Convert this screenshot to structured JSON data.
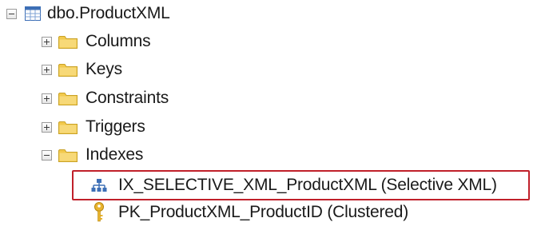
{
  "tree": {
    "root": {
      "label": "dbo.ProductXML",
      "icon": "table-icon",
      "state": "expanded"
    },
    "folders": [
      {
        "label": "Columns",
        "icon": "folder-icon",
        "state": "collapsed"
      },
      {
        "label": "Keys",
        "icon": "folder-icon",
        "state": "collapsed"
      },
      {
        "label": "Constraints",
        "icon": "folder-icon",
        "state": "collapsed"
      },
      {
        "label": "Triggers",
        "icon": "folder-icon",
        "state": "collapsed"
      },
      {
        "label": "Indexes",
        "icon": "folder-icon",
        "state": "expanded"
      }
    ],
    "indexes": [
      {
        "label": "IX_SELECTIVE_XML_ProductXML (Selective XML)",
        "icon": "index-icon",
        "highlighted": true
      },
      {
        "label": "PK_ProductXML_ProductID (Clustered)",
        "icon": "key-icon",
        "highlighted": false
      }
    ]
  },
  "colors": {
    "highlight_border": "#c0202a",
    "folder": "#f2c94c",
    "table_icon": "#3d6fb6"
  }
}
